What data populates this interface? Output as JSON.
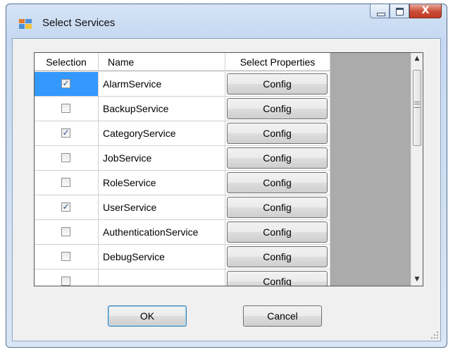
{
  "window": {
    "title": "Select Services",
    "close_symbol": "X"
  },
  "grid": {
    "headers": {
      "selection": "Selection",
      "name": "Name",
      "properties": "Select Properties"
    },
    "rows": [
      {
        "name": "AlarmService",
        "checked": true,
        "selected": true,
        "button": "Config"
      },
      {
        "name": "BackupService",
        "checked": false,
        "selected": false,
        "button": "Config"
      },
      {
        "name": "CategoryService",
        "checked": true,
        "selected": false,
        "button": "Config"
      },
      {
        "name": "JobService",
        "checked": false,
        "selected": false,
        "button": "Config"
      },
      {
        "name": "RoleService",
        "checked": false,
        "selected": false,
        "button": "Config"
      },
      {
        "name": "UserService",
        "checked": true,
        "selected": false,
        "button": "Config"
      },
      {
        "name": "AuthenticationService",
        "checked": false,
        "selected": false,
        "button": "Config"
      },
      {
        "name": "DebugService",
        "checked": false,
        "selected": false,
        "button": "Config"
      },
      {
        "name": "",
        "checked": false,
        "selected": false,
        "button": "Config"
      }
    ],
    "check_symbol": "✓",
    "scroll_up_symbol": "▲",
    "scroll_down_symbol": "▼"
  },
  "buttons": {
    "ok": "OK",
    "cancel": "Cancel"
  },
  "icons": {
    "app": "app-window-icon",
    "minimize": "minimize-icon",
    "maximize": "maximize-icon",
    "close": "close-icon"
  },
  "colors": {
    "selection_highlight": "#3399ff",
    "grid_background": "#ababab",
    "window_frame": "#c6d9f1",
    "close_button": "#c94c36"
  }
}
